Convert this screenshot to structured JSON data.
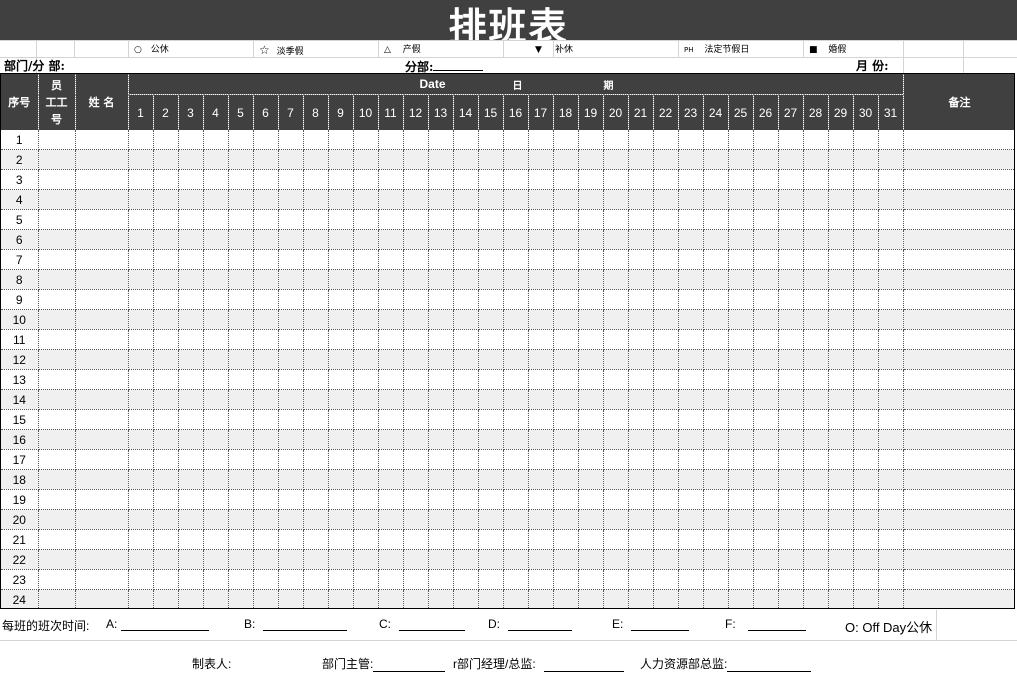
{
  "title": "排班表",
  "legend": [
    {
      "icon": "○",
      "icon_name": "circle-icon",
      "label": "公休"
    },
    {
      "icon": "☆",
      "icon_name": "star-icon",
      "label": "淡季假"
    },
    {
      "icon": "△",
      "icon_name": "triangle-icon",
      "label": "产假"
    },
    {
      "icon": "▼",
      "icon_name": "down-triangle-icon",
      "label": "补休"
    },
    {
      "icon": "PH",
      "icon_name": "ph-icon",
      "label": "法定节假日"
    },
    {
      "icon": "■",
      "icon_name": "square-icon",
      "label": "婚假"
    }
  ],
  "info": {
    "department": "部门/分 部:",
    "branch": "分部:",
    "month": "月 份:"
  },
  "header": {
    "serial": "序号",
    "employee_id_top": "员",
    "employee_id_mid": "工工",
    "employee_id_bottom": "号",
    "name": "姓 名",
    "date": "Date",
    "ri": "日",
    "qi": "期",
    "remark": "备注"
  },
  "days": [
    "1",
    "2",
    "3",
    "4",
    "5",
    "6",
    "7",
    "8",
    "9",
    "10",
    "11",
    "12",
    "13",
    "14",
    "15",
    "16",
    "17",
    "18",
    "19",
    "20",
    "21",
    "22",
    "23",
    "24",
    "25",
    "26",
    "27",
    "28",
    "29",
    "30",
    "31"
  ],
  "rows": [
    "1",
    "2",
    "3",
    "4",
    "5",
    "6",
    "7",
    "8",
    "9",
    "10",
    "11",
    "12",
    "13",
    "14",
    "15",
    "16",
    "17",
    "18",
    "19",
    "20",
    "21",
    "22",
    "23",
    "24"
  ],
  "footer": {
    "shift_time": "每班的班次时间:",
    "a": "A:",
    "b": "B:",
    "c": "C:",
    "d": "D:",
    "e": "E:",
    "f": "F:",
    "off": "O: Off Day公休",
    "maker": "制表人:",
    "dept_head": "部门主管:",
    "manager": "r部门经理/总监:",
    "hr": "人力资源部总监:"
  }
}
